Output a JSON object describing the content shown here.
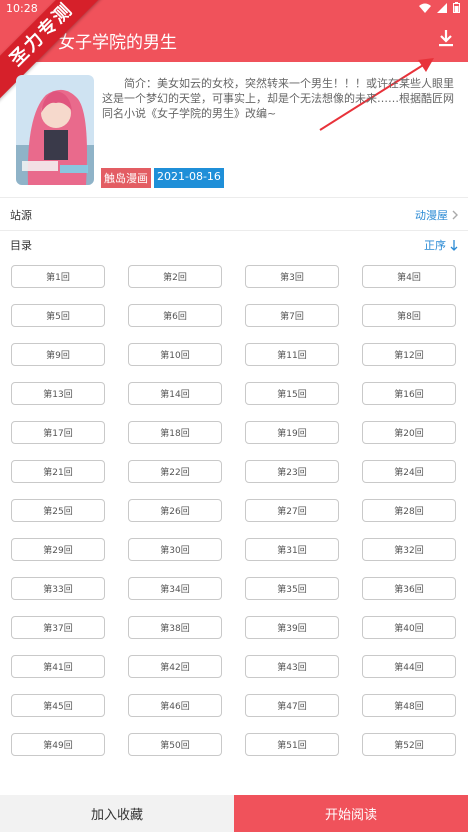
{
  "status": {
    "time": "10:28"
  },
  "header": {
    "title": "女子学院的男生",
    "download_icon": "download-icon"
  },
  "watermark": {
    "text": "圣力专测"
  },
  "book": {
    "intro": "简介：美女如云的女校，突然转来一个男生！！！或许在某些人眼里这是一个梦幻的天堂，可事实上，却是个无法想像的未来……根据酷匠网同名小说《女子学院的男生》改编~",
    "source_tag": "触岛漫画",
    "date_tag": "2021-08-16"
  },
  "site": {
    "label": "站源",
    "value": "动漫屋"
  },
  "catalog": {
    "label": "目录",
    "order": "正序"
  },
  "episodes": [
    "第1回",
    "第2回",
    "第3回",
    "第4回",
    "第5回",
    "第6回",
    "第7回",
    "第8回",
    "第9回",
    "第10回",
    "第11回",
    "第12回",
    "第13回",
    "第14回",
    "第15回",
    "第16回",
    "第17回",
    "第18回",
    "第19回",
    "第20回",
    "第21回",
    "第22回",
    "第23回",
    "第24回",
    "第25回",
    "第26回",
    "第27回",
    "第28回",
    "第29回",
    "第30回",
    "第31回",
    "第32回",
    "第33回",
    "第34回",
    "第35回",
    "第36回",
    "第37回",
    "第38回",
    "第39回",
    "第40回",
    "第41回",
    "第42回",
    "第43回",
    "第44回",
    "第45回",
    "第46回",
    "第47回",
    "第48回",
    "第49回",
    "第50回",
    "第51回",
    "第52回"
  ],
  "bottom": {
    "favorite": "加入收藏",
    "read": "开始阅读"
  },
  "colors": {
    "primary": "#f0525b",
    "link": "#2a8ad4"
  }
}
